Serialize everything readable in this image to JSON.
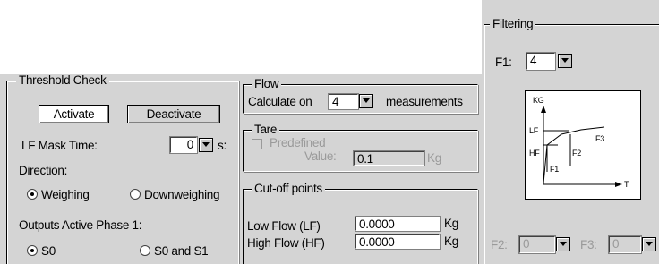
{
  "threshold": {
    "title": "Threshold Check",
    "activate_label": "Activate",
    "deactivate_label": "Deactivate",
    "lf_mask_label": "LF Mask Time:",
    "lf_mask_value": "0",
    "lf_mask_unit": "s:",
    "direction_label": "Direction:",
    "weighing_label": "Weighing",
    "downweighing_label": "Downweighing",
    "outputs_label": "Outputs Active Phase 1:",
    "s0_label": "S0",
    "s0s1_label": "S0 and S1"
  },
  "flow": {
    "title": "Flow",
    "calculate_label": "Calculate on",
    "calculate_value": "4",
    "measurements_label": "measurements"
  },
  "tare": {
    "title": "Tare",
    "predefined_label": "Predefined",
    "value_label": "Value:",
    "value": "0.1",
    "unit": "Kg"
  },
  "cutoff": {
    "title": "Cut-off points",
    "low_label": "Low Flow (LF)",
    "low_value": "0.0000",
    "low_unit": "Kg",
    "high_label": "High Flow (HF)",
    "high_value": "0.0000",
    "high_unit": "Kg"
  },
  "filtering": {
    "title": "Filtering",
    "f1_label": "F1:",
    "f1_value": "4",
    "f2_label": "F2:",
    "f2_value": "0",
    "f3_label": "F3:",
    "f3_value": "0",
    "graph": {
      "y_label": "KG",
      "x_label": "T",
      "lf": "LF",
      "hf": "HF",
      "f1": "F1",
      "f2": "F2",
      "f3": "F3"
    }
  }
}
